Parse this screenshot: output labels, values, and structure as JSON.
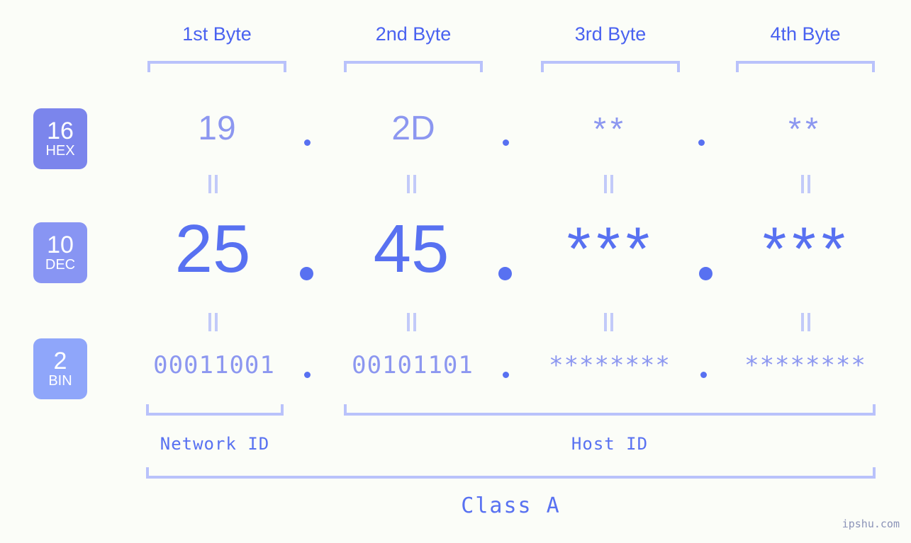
{
  "meta": {
    "background": "#fbfdf8",
    "accent": "#5871f1",
    "accent_light": "#8c97f0",
    "bracket_color": "#b9c2fb"
  },
  "columns": [
    {
      "header": "1st Byte"
    },
    {
      "header": "2nd Byte"
    },
    {
      "header": "3rd Byte"
    },
    {
      "header": "4th Byte"
    }
  ],
  "rows": [
    {
      "badge_number": "16",
      "badge_name": "HEX",
      "badge_color": "#7b85ec",
      "values": [
        "19",
        "2D",
        "**",
        "**"
      ],
      "separator": "."
    },
    {
      "badge_number": "10",
      "badge_name": "DEC",
      "badge_color": "#8895f3",
      "values": [
        "25",
        "45",
        "***",
        "***"
      ],
      "separator": "."
    },
    {
      "badge_number": "2",
      "badge_name": "BIN",
      "badge_color": "#8fa6fa",
      "values": [
        "00011001",
        "00101101",
        "********",
        "********"
      ],
      "separator": "."
    }
  ],
  "connector": "=",
  "id_sections": [
    {
      "label": "Network ID"
    },
    {
      "label": "Host ID"
    }
  ],
  "class_label": "Class A",
  "watermark": "ipshu.com"
}
